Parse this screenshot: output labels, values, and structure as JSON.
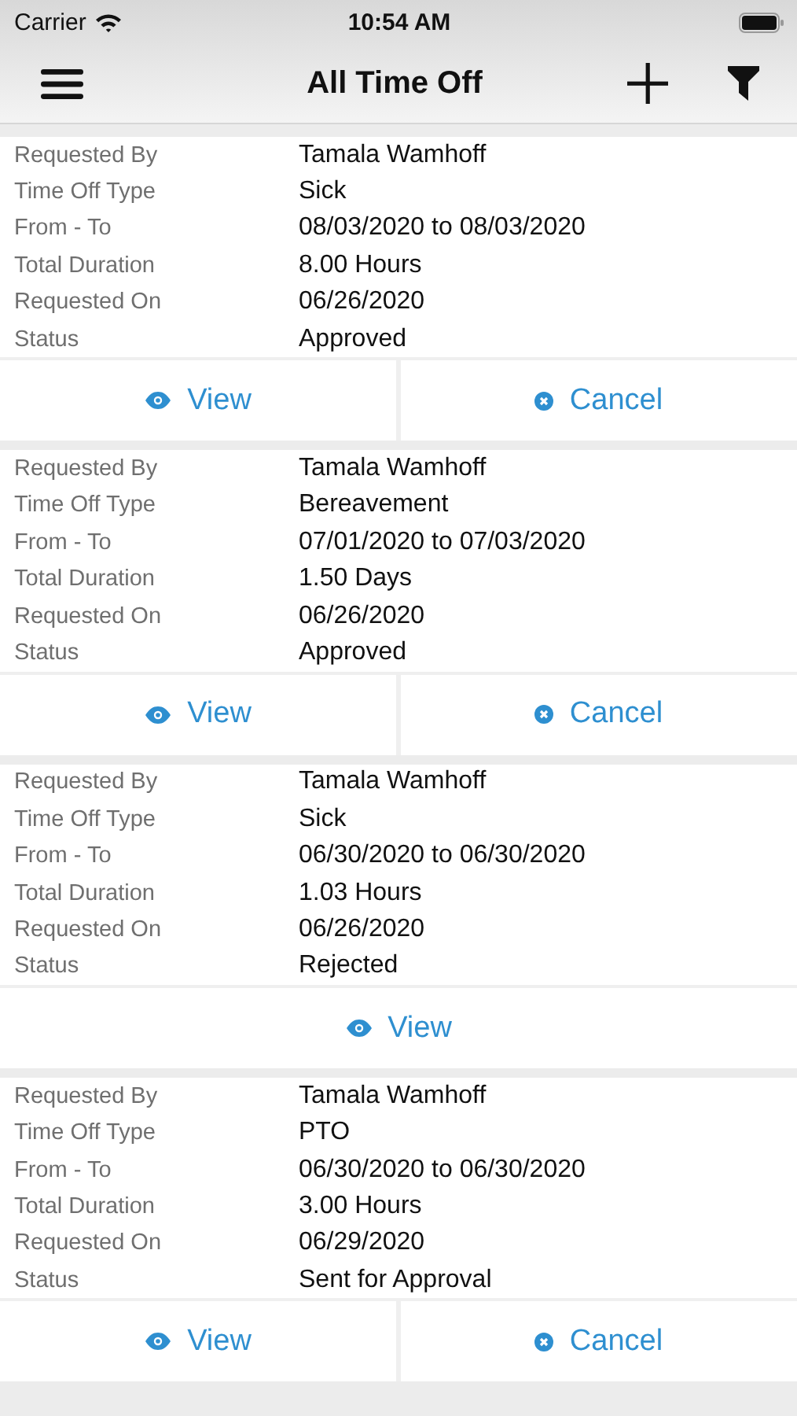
{
  "status_bar": {
    "carrier": "Carrier",
    "time": "10:54 AM"
  },
  "nav": {
    "title": "All Time Off"
  },
  "requests": [
    {
      "fields": [
        {
          "label": "Requested By",
          "value": "Tamala Wamhoff"
        },
        {
          "label": "Time Off Type",
          "value": "Sick"
        },
        {
          "label": "From - To",
          "value": "08/03/2020 to 08/03/2020"
        },
        {
          "label": "Total Duration",
          "value": "8.00 Hours"
        },
        {
          "label": "Requested On",
          "value": "06/26/2020"
        },
        {
          "label": "Status",
          "value": "Approved"
        }
      ],
      "actions": [
        {
          "kind": "view",
          "label": "View"
        },
        {
          "kind": "cancel",
          "label": "Cancel"
        }
      ]
    },
    {
      "fields": [
        {
          "label": "Requested By",
          "value": "Tamala Wamhoff"
        },
        {
          "label": "Time Off Type",
          "value": "Bereavement"
        },
        {
          "label": "From - To",
          "value": "07/01/2020 to 07/03/2020"
        },
        {
          "label": "Total Duration",
          "value": "1.50 Days"
        },
        {
          "label": "Requested On",
          "value": "06/26/2020"
        },
        {
          "label": "Status",
          "value": "Approved"
        }
      ],
      "actions": [
        {
          "kind": "view",
          "label": "View"
        },
        {
          "kind": "cancel",
          "label": "Cancel"
        }
      ]
    },
    {
      "fields": [
        {
          "label": "Requested By",
          "value": "Tamala Wamhoff"
        },
        {
          "label": "Time Off Type",
          "value": "Sick"
        },
        {
          "label": "From - To",
          "value": "06/30/2020 to 06/30/2020"
        },
        {
          "label": "Total Duration",
          "value": "1.03 Hours"
        },
        {
          "label": "Requested On",
          "value": "06/26/2020"
        },
        {
          "label": "Status",
          "value": "Rejected"
        }
      ],
      "actions": [
        {
          "kind": "view",
          "label": "View"
        }
      ]
    },
    {
      "fields": [
        {
          "label": "Requested By",
          "value": "Tamala Wamhoff"
        },
        {
          "label": "Time Off Type",
          "value": "PTO"
        },
        {
          "label": "From - To",
          "value": "06/30/2020 to 06/30/2020"
        },
        {
          "label": "Total Duration",
          "value": "3.00 Hours"
        },
        {
          "label": "Requested On",
          "value": "06/29/2020"
        },
        {
          "label": "Status",
          "value": "Sent for Approval"
        }
      ],
      "actions": [
        {
          "kind": "view",
          "label": "View"
        },
        {
          "kind": "cancel",
          "label": "Cancel"
        }
      ]
    }
  ]
}
